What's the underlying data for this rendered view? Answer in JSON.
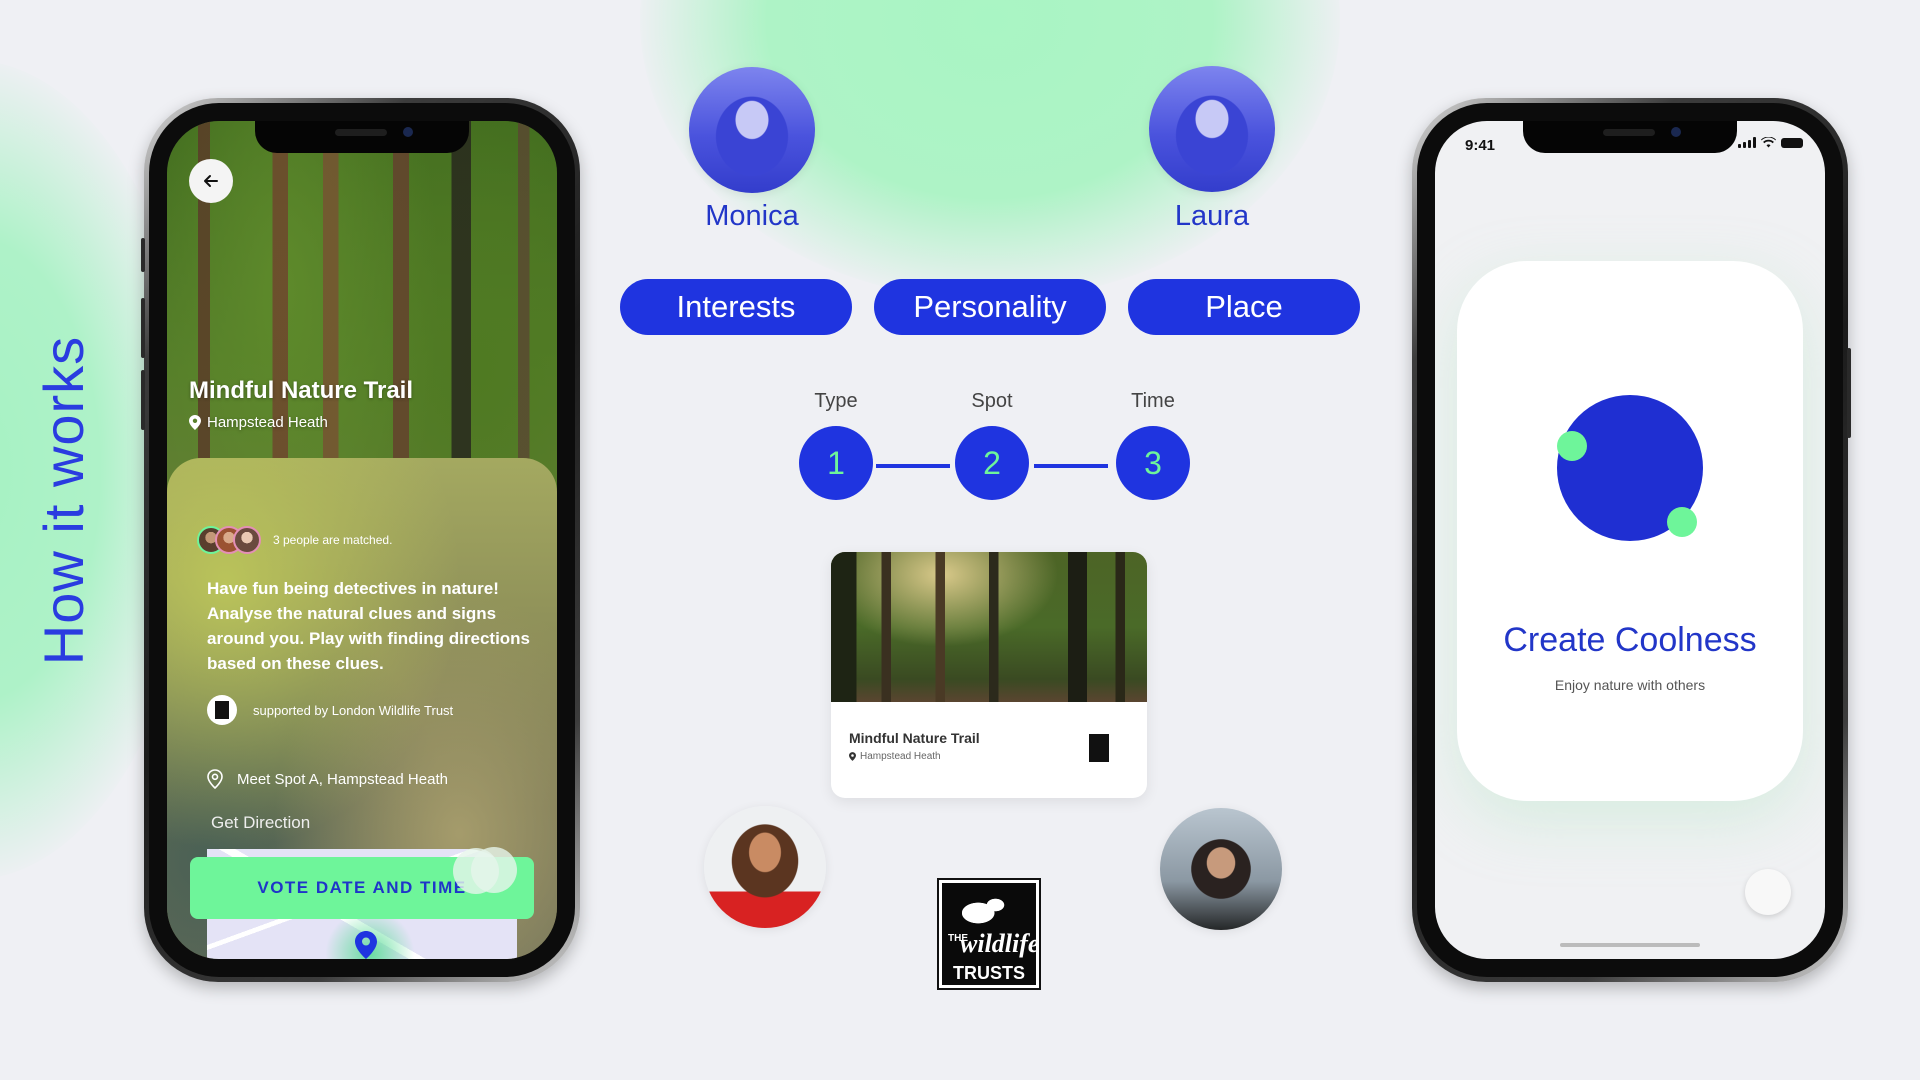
{
  "section_title": "How it works",
  "colors": {
    "accent_blue": "#1f34e0",
    "accent_green": "#6ef59a",
    "background": "#eff0f4"
  },
  "left_phone": {
    "back_icon": "arrow-left-icon",
    "trail_title": "Mindful Nature Trail",
    "trail_location": "Hampstead Heath",
    "matched_text": "3 people are matched.",
    "description": "Have fun being detectives in nature! Analyse the natural clues and signs around you. Play with finding directions based on these clues.",
    "supported_by": "supported by London Wildlife Trust",
    "meet_spot": "Meet Spot A, Hampstead Heath",
    "get_direction": "Get Direction",
    "vote_button": "VOTE DATE AND TIME"
  },
  "center": {
    "people_top": [
      {
        "name": "Monica"
      },
      {
        "name": "Laura"
      }
    ],
    "pills": [
      "Interests",
      "Personality",
      "Place"
    ],
    "steps": [
      {
        "label": "Type",
        "number": "1"
      },
      {
        "label": "Spot",
        "number": "2"
      },
      {
        "label": "Time",
        "number": "3"
      }
    ],
    "trail_card": {
      "title": "Mindful Nature Trail",
      "location": "Hampstead Heath"
    },
    "logo": {
      "the": "THE",
      "wildlife": "wildlife",
      "trusts": "TRUSTS"
    }
  },
  "right_phone": {
    "status_time": "9:41",
    "title": "Create Coolness",
    "subtitle": "Enjoy nature with others"
  }
}
